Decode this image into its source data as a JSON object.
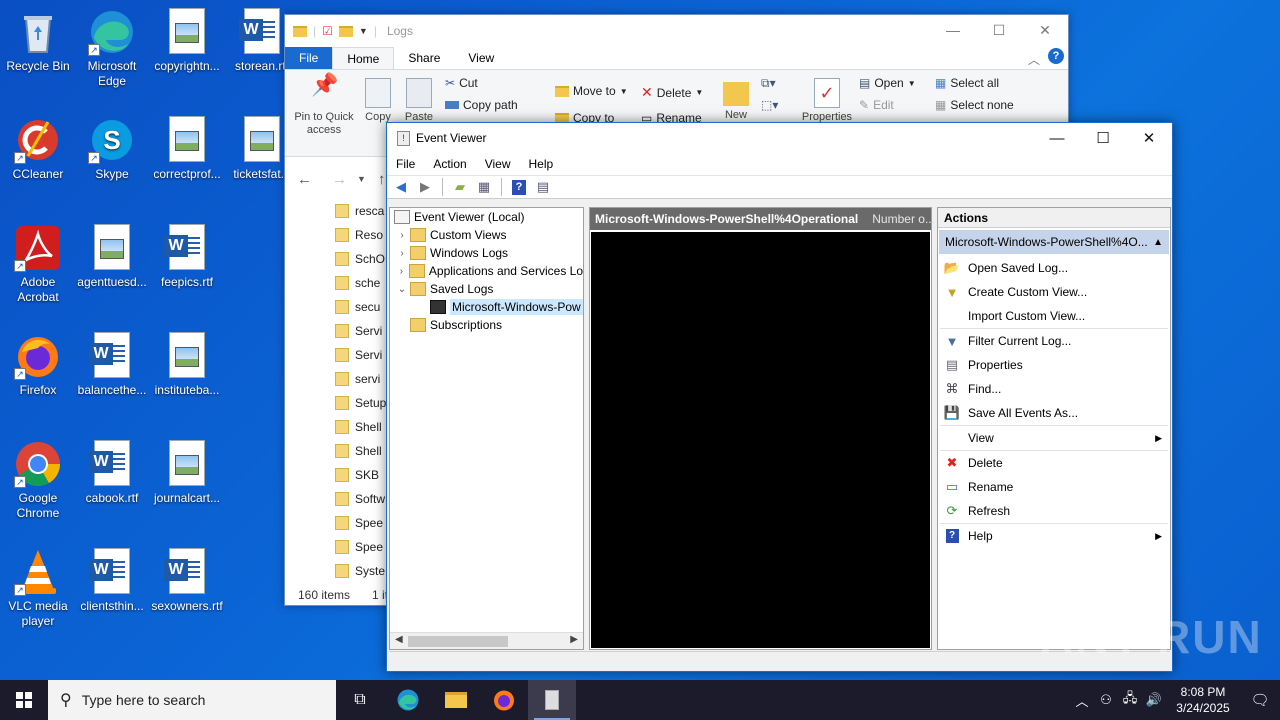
{
  "desktop": {
    "icons": [
      {
        "label": "Recycle Bin",
        "icon": "recycle-bin-icon"
      },
      {
        "label": "Microsoft Edge",
        "icon": "edge-icon"
      },
      {
        "label": "copyrightn...",
        "icon": "image-file-icon"
      },
      {
        "label": "storean.rtf",
        "icon": "word-file-icon"
      },
      {
        "label": "CCleaner",
        "icon": "ccleaner-icon"
      },
      {
        "label": "Skype",
        "icon": "skype-icon"
      },
      {
        "label": "correctprof...",
        "icon": "image-file-icon"
      },
      {
        "label": "ticketsfat...",
        "icon": "image-file-icon"
      },
      {
        "label": "Adobe Acrobat",
        "icon": "acrobat-icon"
      },
      {
        "label": "agenttuesd...",
        "icon": "image-file-icon"
      },
      {
        "label": "feepics.rtf",
        "icon": "word-file-icon"
      },
      {
        "label": "Firefox",
        "icon": "firefox-icon"
      },
      {
        "label": "balancethe...",
        "icon": "word-file-icon"
      },
      {
        "label": "instituteba...",
        "icon": "image-file-icon"
      },
      {
        "label": "Google Chrome",
        "icon": "chrome-icon"
      },
      {
        "label": "cabook.rtf",
        "icon": "word-file-icon"
      },
      {
        "label": "journalcart...",
        "icon": "image-file-icon"
      },
      {
        "label": "VLC media player",
        "icon": "vlc-icon"
      },
      {
        "label": "clientsthin...",
        "icon": "word-file-icon"
      },
      {
        "label": "sexowners.rtf",
        "icon": "word-file-icon"
      }
    ]
  },
  "explorer": {
    "title": "Logs",
    "tabs": [
      "File",
      "Home",
      "Share",
      "View"
    ],
    "ribbon": {
      "pin": "Pin to Quick access",
      "copy": "Copy",
      "paste": "Paste",
      "cut": "Cut",
      "copy_path": "Copy path",
      "move_to": "Move to",
      "copy_to": "Copy to",
      "delete": "Delete",
      "rename": "Rename",
      "new": "New",
      "properties": "Properties",
      "open": "Open",
      "edit": "Edit",
      "select_all": "Select all",
      "select_none": "Select none"
    },
    "rows": [
      "resca",
      "Reso",
      "SchO",
      "sche",
      "secu",
      "Servi",
      "Servi",
      "servi",
      "Setup",
      "Shell",
      "Shell",
      "SKB",
      "Softw",
      "Spee",
      "Spee",
      "Syste"
    ],
    "status_items": "160 items",
    "status_selected": "1 it"
  },
  "event_viewer": {
    "title": "Event Viewer",
    "menu": [
      "File",
      "Action",
      "View",
      "Help"
    ],
    "tree": {
      "root": "Event Viewer (Local)",
      "custom_views": "Custom Views",
      "windows_logs": "Windows Logs",
      "app_services": "Applications and Services Lo",
      "saved_logs": "Saved Logs",
      "saved_log_item": "Microsoft-Windows-Pow",
      "subscriptions": "Subscriptions"
    },
    "center": {
      "header": "Microsoft-Windows-PowerShell%4Operational",
      "subheader": "Number o..."
    },
    "actions": {
      "header": "Actions",
      "section": "Microsoft-Windows-PowerShell%4O...",
      "items": {
        "open_saved": "Open Saved Log...",
        "create_custom": "Create Custom View...",
        "import_custom": "Import Custom View...",
        "filter": "Filter Current Log...",
        "properties": "Properties",
        "find": "Find...",
        "save_all": "Save All Events As...",
        "view": "View",
        "delete": "Delete",
        "rename": "Rename",
        "refresh": "Refresh",
        "help": "Help"
      }
    }
  },
  "taskbar": {
    "search_placeholder": "Type here to search",
    "time": "8:08 PM",
    "date": "3/24/2025"
  },
  "watermark": "ANY RUN"
}
